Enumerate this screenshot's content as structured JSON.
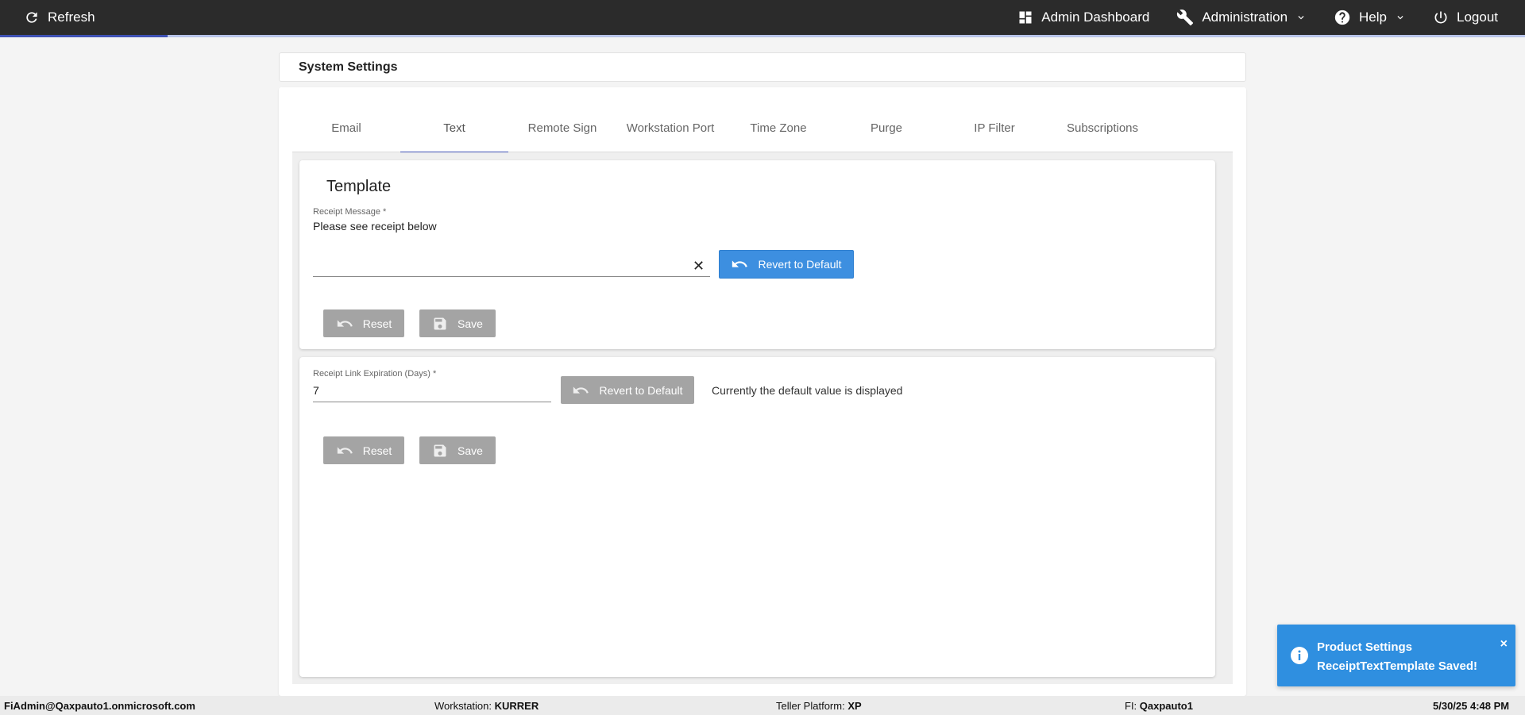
{
  "topbar": {
    "refresh_label": "Refresh",
    "admin_dashboard_label": "Admin Dashboard",
    "administration_label": "Administration",
    "help_label": "Help",
    "logout_label": "Logout",
    "loading_progress": 0.11
  },
  "header": {
    "title": "System Settings"
  },
  "tabs": [
    {
      "label": "Email"
    },
    {
      "label": "Text"
    },
    {
      "label": "Remote Sign"
    },
    {
      "label": "Workstation Port"
    },
    {
      "label": "Time Zone"
    },
    {
      "label": "Purge"
    },
    {
      "label": "IP Filter"
    },
    {
      "label": "Subscriptions"
    }
  ],
  "active_tab": "Text",
  "template_panel": {
    "title": "Template",
    "receipt_message_label": "Receipt Message *",
    "receipt_message_value": "Please see receipt below",
    "revert_label": "Revert to Default",
    "reset_label": "Reset",
    "save_label": "Save"
  },
  "expiration_panel": {
    "field_label": "Receipt Link Expiration (Days) *",
    "field_value": "7",
    "revert_label": "Revert to Default",
    "note": "Currently the default value is displayed",
    "reset_label": "Reset",
    "save_label": "Save"
  },
  "toast": {
    "line1": "Product Settings",
    "line2": "ReceiptTextTemplate Saved!",
    "close": "×"
  },
  "footer": {
    "user": "FiAdmin@Qaxpauto1.onmicrosoft.com",
    "workstation_label": "Workstation: ",
    "workstation_value": "KURRER",
    "platform_label": "Teller Platform: ",
    "platform_value": "XP",
    "fi_label": "FI: ",
    "fi_value": "Qaxpauto1",
    "datetime": "5/30/25 4:48 PM"
  },
  "colors": {
    "accent": "#3f51b5",
    "primary_button": "#3d8fe0",
    "disabled_button": "#a4a4a4",
    "toast": "#2f8fe0"
  }
}
